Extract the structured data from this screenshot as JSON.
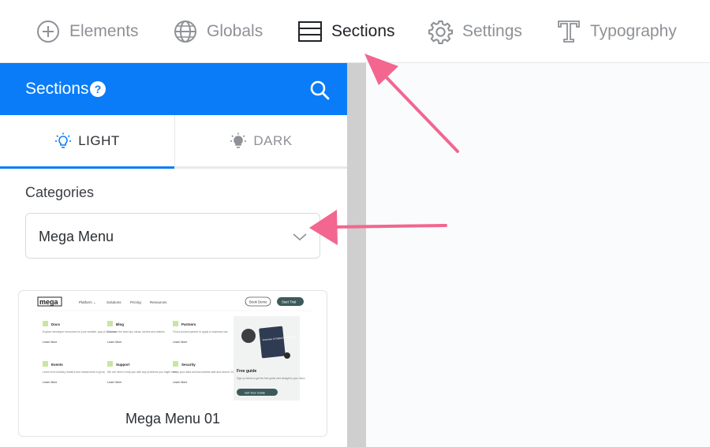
{
  "toolbar": {
    "items": [
      {
        "label": "Elements",
        "icon": "plus-circle-icon"
      },
      {
        "label": "Globals",
        "icon": "globe-icon"
      },
      {
        "label": "Sections",
        "icon": "sections-icon"
      },
      {
        "label": "Settings",
        "icon": "gear-icon"
      },
      {
        "label": "Typography",
        "icon": "typography-icon"
      }
    ],
    "active": "Sections"
  },
  "panel": {
    "title": "Sections",
    "help": "?",
    "tabs": [
      {
        "label": "LIGHT",
        "icon": "lightbulb-outline-icon",
        "selected": true
      },
      {
        "label": "DARK",
        "icon": "lightbulb-filled-icon",
        "selected": false
      }
    ],
    "categories_label": "Categories",
    "category_value": "Mega Menu",
    "cards": [
      {
        "title": "Mega Menu 01",
        "preview": {
          "logo": "mega",
          "nav": [
            "Platform ⌄",
            "Solutions",
            "Pricing",
            "Resources"
          ],
          "buttons": [
            "Book Demo",
            "Start Trial"
          ],
          "features": [
            {
              "title": "Docs",
              "text": "Explore developer resources for your website, app or business.",
              "link": "Learn More"
            },
            {
              "title": "Blog",
              "text": "Discover the best tips, ideas, stories and articles.",
              "link": "Learn More"
            },
            {
              "title": "Partners",
              "text": "Find a trusted partner to apply in business use.",
              "link": "Learn More"
            },
            {
              "title": "Events",
              "text": "Learn from industry leaders and researchers to grow.",
              "link": "Learn More"
            },
            {
              "title": "Support",
              "text": "We are here to help you with any problems you might have.",
              "link": "Learn More"
            },
            {
              "title": "Security",
              "text": "Keep your data and documents safe and secure 24/7.",
              "link": "Learn More"
            }
          ],
          "guide_book": "Overview of Digital Photography",
          "guide_title": "Free guide",
          "guide_text": "Sign up below to get the free guide sent straight to your inbox.",
          "guide_button": "Get Your Guide"
        }
      }
    ]
  },
  "colors": {
    "accent": "#0a7cf8",
    "annotation_arrow": "#f2668f",
    "active_text": "#1f2328",
    "inactive_text": "#8e9196"
  }
}
